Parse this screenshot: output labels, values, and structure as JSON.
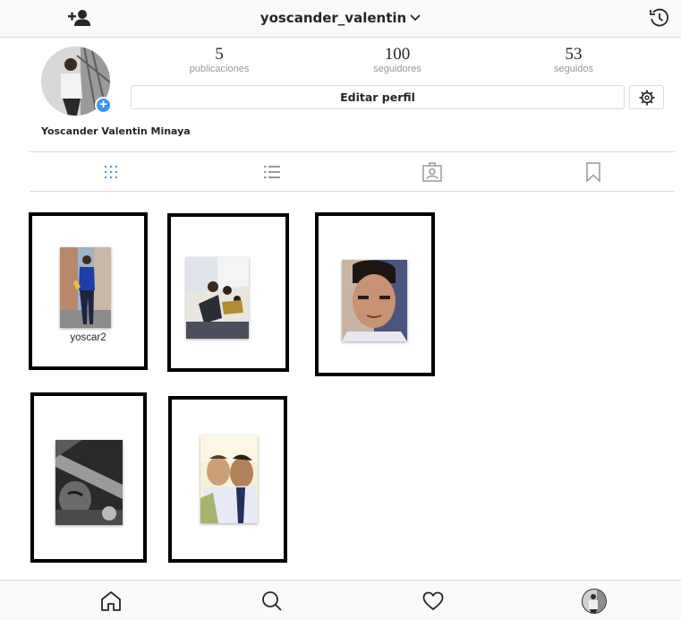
{
  "header": {
    "username": "yoscander_valentin",
    "icons": [
      "add-user-icon",
      "chevron-down-icon",
      "history-icon"
    ]
  },
  "profile": {
    "full_name": "Yoscander Valentin Minaya",
    "stats": {
      "posts": {
        "value": "5",
        "label": "publicaciones"
      },
      "followers": {
        "value": "100",
        "label": "seguidores"
      },
      "following": {
        "value": "53",
        "label": "seguidos"
      }
    },
    "edit_label": "Editar perfil",
    "avatar_badge": "+"
  },
  "tabs": [
    "grid-icon",
    "list-icon",
    "tagged-icon",
    "saved-icon"
  ],
  "active_tab": "grid",
  "posts": [
    {
      "caption": "yoscar2"
    },
    {
      "caption": ""
    },
    {
      "caption": ""
    },
    {
      "caption": ""
    },
    {
      "caption": ""
    }
  ],
  "bottom_nav": [
    "home-icon",
    "search-icon",
    "heart-icon",
    "profile-avatar"
  ],
  "colors": {
    "accent": "#3897f0",
    "border": "#dbdbdb",
    "muted": "#999999",
    "text": "#262626"
  }
}
